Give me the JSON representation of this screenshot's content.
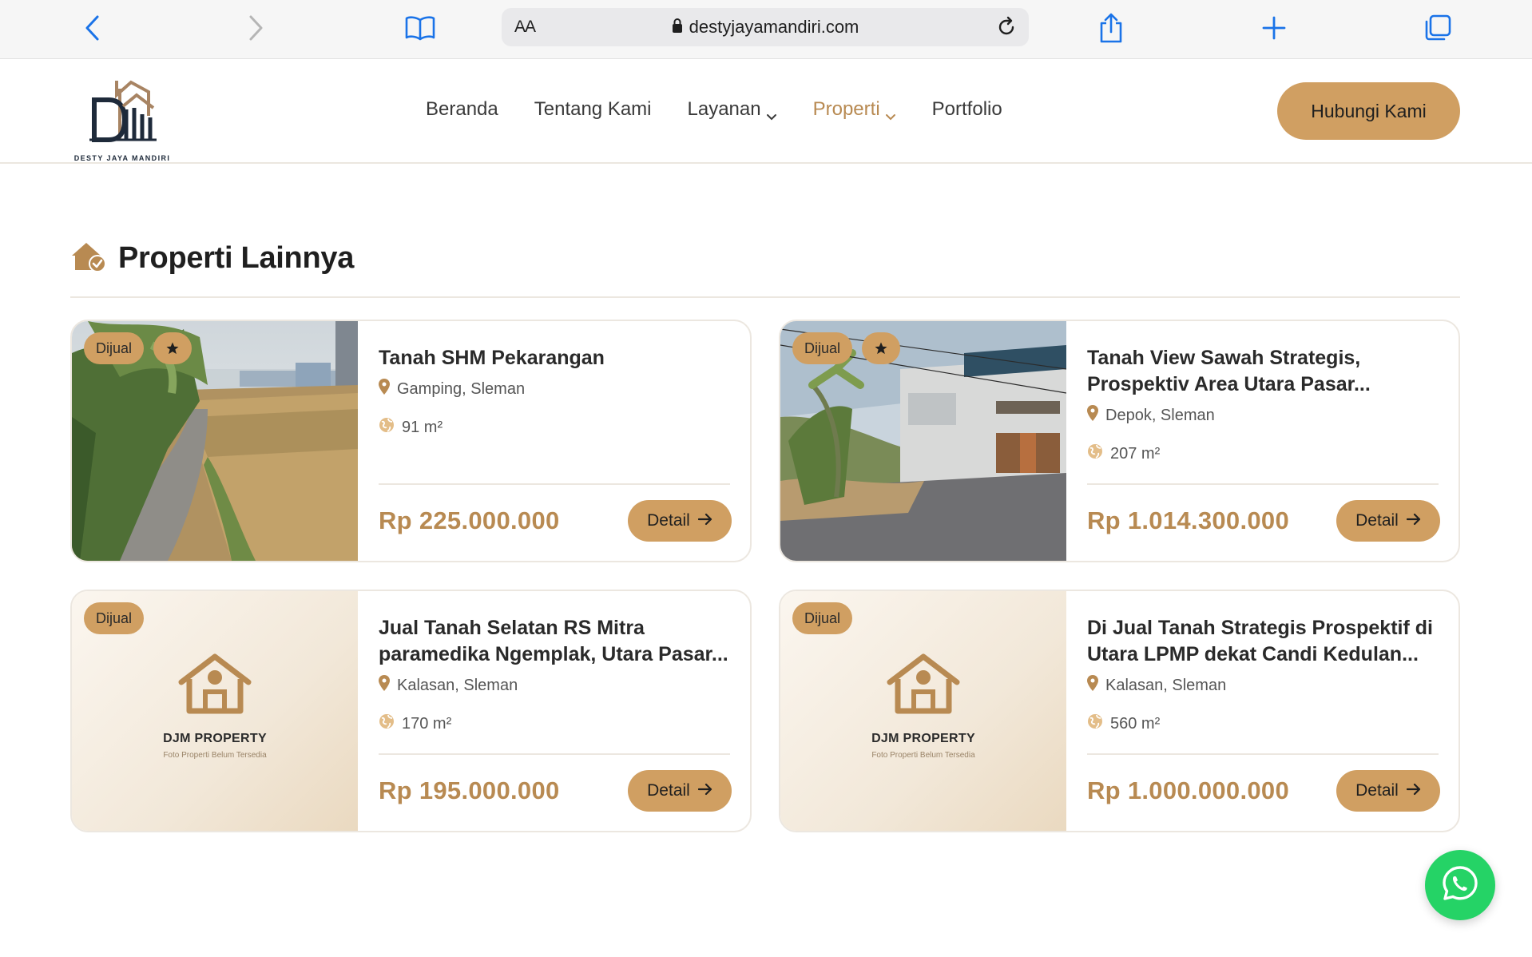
{
  "browser": {
    "reader_label": "AA",
    "url": "destyjayamandiri.com"
  },
  "site": {
    "logo_text": "DESTY JAYA MANDIRI",
    "nav": [
      {
        "label": "Beranda"
      },
      {
        "label": "Tentang Kami"
      },
      {
        "label": "Layanan"
      },
      {
        "label": "Properti"
      },
      {
        "label": "Portfolio"
      }
    ],
    "active_nav": "Properti",
    "cta_label": "Hubungi Kami"
  },
  "section": {
    "title": "Properti Lainnya"
  },
  "properties": [
    {
      "badge": "Dijual",
      "featured": true,
      "photo": "land-path",
      "title": "Tanah SHM Pekarangan",
      "location": "Gamping, Sleman",
      "area": "91 m²",
      "price": "Rp 225.000.000",
      "action": "Detail"
    },
    {
      "badge": "Dijual",
      "featured": true,
      "photo": "land-building",
      "title": "Tanah View Sawah Strategis, Prospektiv Area Utara Pasar...",
      "location": "Depok, Sleman",
      "area": "207 m²",
      "price": "Rp 1.014.300.000",
      "action": "Detail"
    },
    {
      "badge": "Dijual",
      "featured": false,
      "photo": "placeholder",
      "placeholder_title": "DJM PROPERTY",
      "placeholder_sub": "Foto Properti Belum Tersedia",
      "title": "Jual Tanah Selatan RS Mitra paramedika Ngemplak, Utara Pasar...",
      "location": "Kalasan, Sleman",
      "area": "170 m²",
      "price": "Rp 195.000.000",
      "action": "Detail"
    },
    {
      "badge": "Dijual",
      "featured": false,
      "photo": "placeholder",
      "placeholder_title": "DJM PROPERTY",
      "placeholder_sub": "Foto Properti Belum Tersedia",
      "title": "Di Jual Tanah Strategis Prospektif di Utara LPMP dekat Candi Kedulan...",
      "location": "Kalasan, Sleman",
      "area": "560 m²",
      "price": "Rp 1.000.000.000",
      "action": "Detail"
    }
  ],
  "colors": {
    "accent": "#d09f62",
    "accent_text": "#b88a52",
    "whatsapp": "#25d366"
  }
}
